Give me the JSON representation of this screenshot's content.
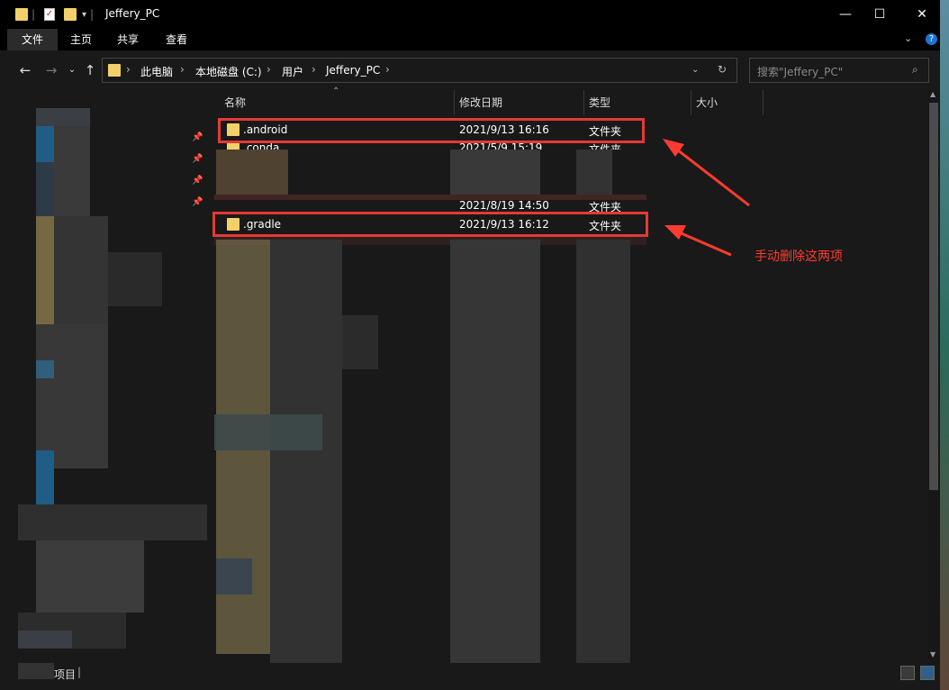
{
  "window": {
    "title": "Jeffery_PC",
    "controls": [
      "—",
      "☐",
      "✕"
    ]
  },
  "ribbon": {
    "tabs": [
      {
        "label": "文件",
        "active": true
      },
      {
        "label": "主页",
        "active": false
      },
      {
        "label": "共享",
        "active": false
      },
      {
        "label": "查看",
        "active": false
      }
    ]
  },
  "address": {
    "crumbs": [
      "此电脑",
      "本地磁盘 (C:)",
      "用户",
      "Jeffery_PC"
    ],
    "search_placeholder": "搜索\"Jeffery_PC\""
  },
  "columns": [
    "名称",
    "修改日期",
    "类型",
    "大小"
  ],
  "rows": [
    {
      "name": ".android",
      "date": "2021/9/13 16:16",
      "type": "文件夹"
    },
    {
      "name": ".conda",
      "date": "2021/5/9 15:19",
      "type": "文件夹"
    },
    {
      "name": "",
      "date": "2021/8/19 14:50",
      "type": "文件夹"
    },
    {
      "name": ".gradle",
      "date": "2021/9/13 16:12",
      "type": "文件夹"
    }
  ],
  "status": {
    "text": "项目"
  },
  "annotation": {
    "text": "手动删除这两项",
    "color": "#ff3b30"
  }
}
